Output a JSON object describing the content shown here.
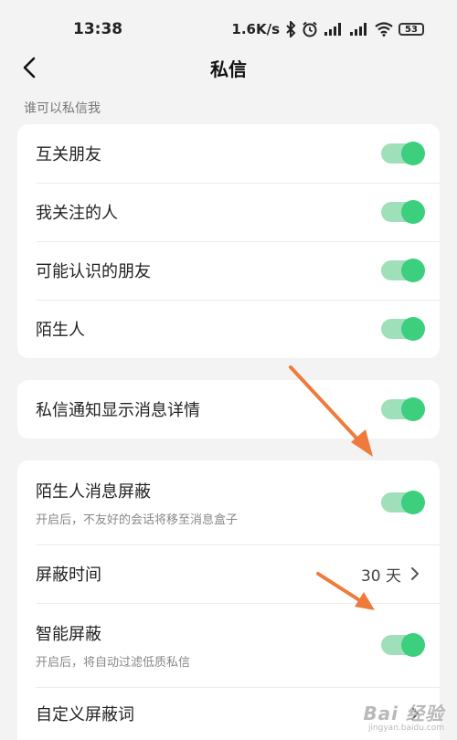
{
  "status_bar": {
    "time": "13:38",
    "speed": "1.6K/s",
    "battery": "53",
    "icons": [
      "bluetooth-icon",
      "alarm-icon",
      "signal-icon",
      "signal-icon",
      "wifi-icon"
    ]
  },
  "nav": {
    "title": "私信",
    "back_icon": "back-chevron-icon"
  },
  "section": {
    "label": "谁可以私信我"
  },
  "group1": [
    {
      "label": "互关朋友",
      "on": true
    },
    {
      "label": "我关注的人",
      "on": true
    },
    {
      "label": "可能认识的朋友",
      "on": true
    },
    {
      "label": "陌生人",
      "on": true
    }
  ],
  "group2": [
    {
      "label": "私信通知显示消息详情",
      "on": true
    }
  ],
  "group3": {
    "stranger_block": {
      "label": "陌生人消息屏蔽",
      "desc": "开启后，不友好的会话将移至消息盒子",
      "on": true
    },
    "block_time": {
      "label": "屏蔽时间",
      "value": "30 天"
    },
    "smart_block": {
      "label": "智能屏蔽",
      "desc": "开启后，将自动过滤低质私信",
      "on": true
    },
    "custom_words": {
      "label": "自定义屏蔽词"
    }
  },
  "watermark": {
    "main": "Bai 经验",
    "sub": "jingyan.baidu.com"
  },
  "colors": {
    "toggle_track": "#9fe0bb",
    "toggle_knob": "#3ccf7e",
    "annotation_arrow": "#ee7b3c",
    "background": "#f3f3f3"
  }
}
